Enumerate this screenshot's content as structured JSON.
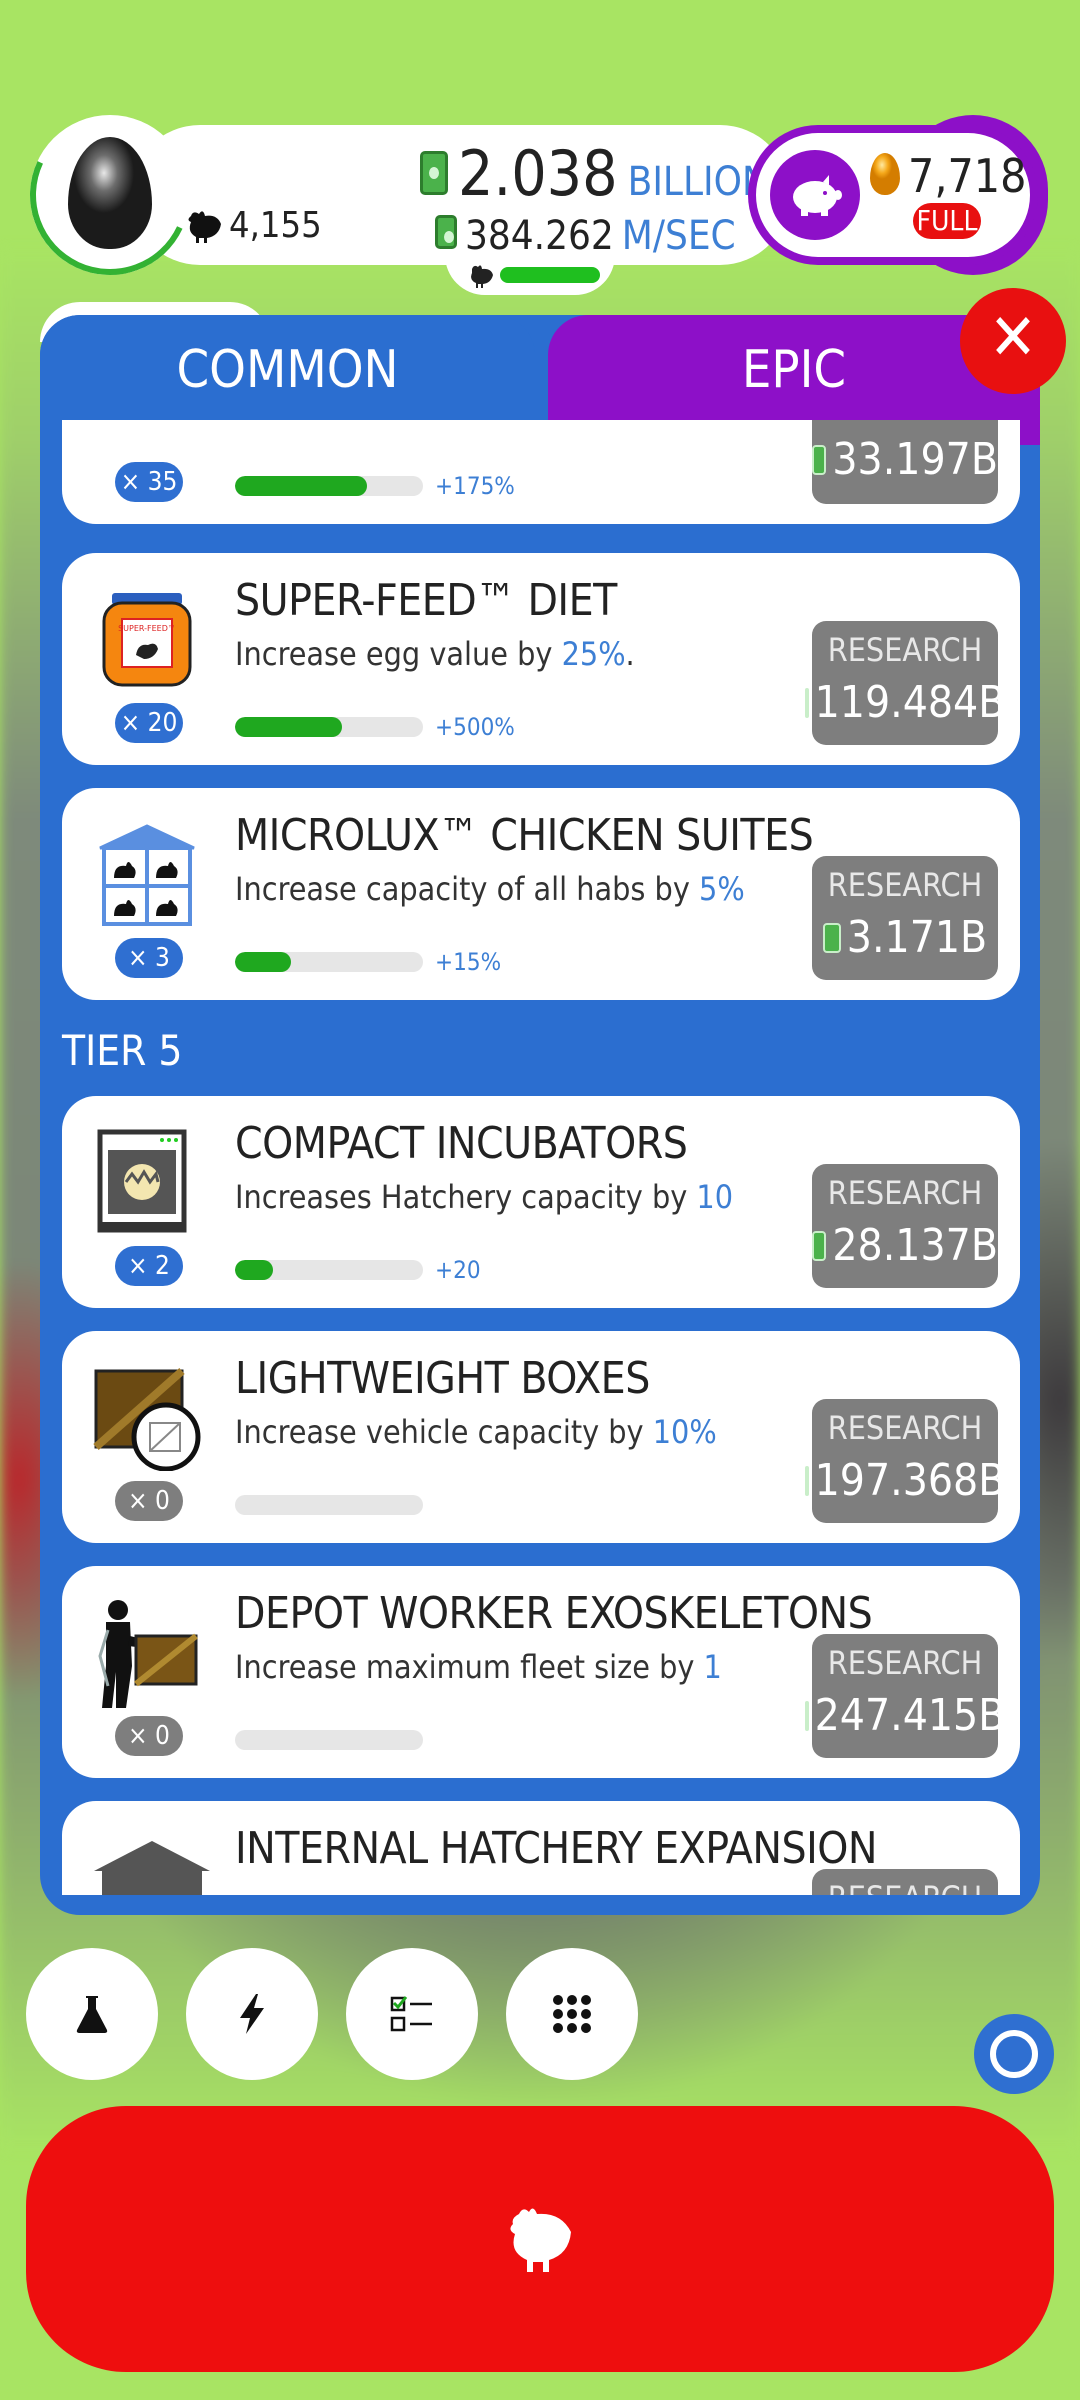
{
  "colors": {
    "background": "#a8e463",
    "panel_blue": "#2b6ed0",
    "epic_purple": "#8d10c8",
    "red": "#ee0e0e",
    "green": "#1fa81f",
    "highlight_blue": "#3d7fd4"
  },
  "topbar": {
    "chicken_count": "4,155",
    "money_value": "2.038",
    "money_unit": "BILLION",
    "rate_value": "384.262",
    "rate_unit": "M/SEC",
    "hab_fill_fraction": 1.0,
    "golden_eggs": "7,718",
    "full_label": "FULL"
  },
  "tabs": {
    "common": "COMMON",
    "epic": "EPIC"
  },
  "research_label": "RESEARCH",
  "items": [
    {
      "title": "",
      "desc_pre": "",
      "desc_hl": "",
      "desc_post": "",
      "level": "× 35",
      "fill": 0.7,
      "bonus": "+175%",
      "cost": "33.197B"
    },
    {
      "title": "SUPER-FEED™ DIET",
      "desc_pre": "Increase egg value by ",
      "desc_hl": "25%",
      "desc_post": ".",
      "level": "× 20",
      "fill": 0.57,
      "bonus": "+500%",
      "cost": "119.484B"
    },
    {
      "title": "MICROLUX™ CHICKEN SUITES",
      "desc_pre": "Increase capacity of all habs by ",
      "desc_hl": "5%",
      "desc_post": "",
      "level": "× 3",
      "fill": 0.3,
      "bonus": "+15%",
      "cost": "3.171B"
    },
    {
      "title": "COMPACT INCUBATORS",
      "desc_pre": "Increases Hatchery capacity by ",
      "desc_hl": "10",
      "desc_post": "",
      "level": "× 2",
      "fill": 0.2,
      "bonus": "+20",
      "cost": "28.137B"
    },
    {
      "title": "LIGHTWEIGHT BOXES",
      "desc_pre": "Increase vehicle capacity by ",
      "desc_hl": "10%",
      "desc_post": "",
      "level": "× 0",
      "fill": 0,
      "bonus": "",
      "cost": "197.368B"
    },
    {
      "title": "DEPOT WORKER EXOSKELETONS",
      "desc_pre": "Increase maximum fleet size by ",
      "desc_hl": "1",
      "desc_post": "",
      "level": "× 0",
      "fill": 0,
      "bonus": "",
      "cost": "247.415B"
    },
    {
      "title": "INTERNAL HATCHERY EXPANSION",
      "desc_pre": "",
      "desc_hl": "",
      "desc_post": "",
      "level": "",
      "fill": 0,
      "bonus": "",
      "cost": ""
    }
  ],
  "tier_label": "TIER 5",
  "bottom": {
    "buttons": [
      "flask-icon",
      "lightning-icon",
      "checklist-icon",
      "grid-icon"
    ]
  }
}
